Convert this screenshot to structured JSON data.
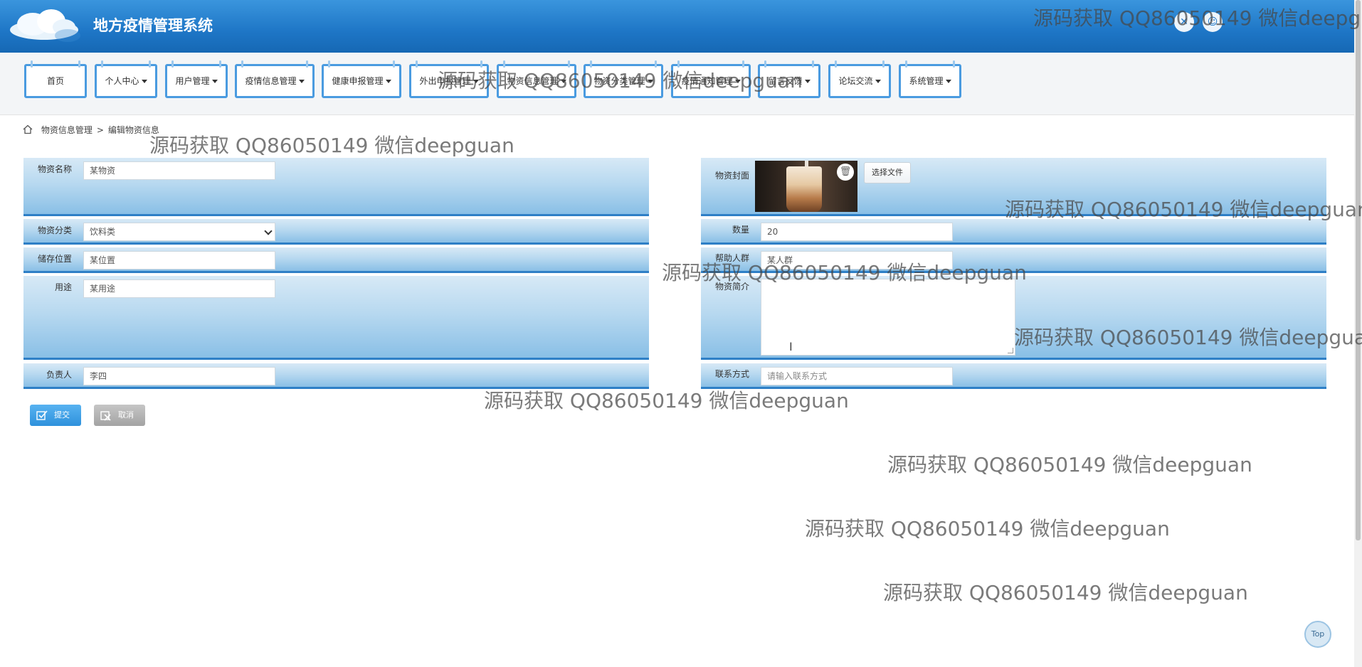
{
  "header": {
    "title": "地方疫情管理系统",
    "settings_icon": "gear-icon",
    "user_icon": "user-icon"
  },
  "nav": {
    "items": [
      {
        "label": "首页"
      },
      {
        "label": "个人中心"
      },
      {
        "label": "用户管理"
      },
      {
        "label": "疫情信息管理"
      },
      {
        "label": "健康申报管理"
      },
      {
        "label": "外出申报管理"
      },
      {
        "label": "物资信息管理"
      },
      {
        "label": "物资分类管理"
      },
      {
        "label": "疫情通知管理"
      },
      {
        "label": "留言反馈"
      },
      {
        "label": "论坛交流"
      },
      {
        "label": "系统管理"
      }
    ]
  },
  "breadcrumb": {
    "parent": "物资信息管理",
    "separator": ">",
    "current": "编辑物资信息"
  },
  "form": {
    "name": {
      "label": "物资名称",
      "value": "某物资"
    },
    "cover": {
      "label": "物资封面",
      "choose_file": "选择文件"
    },
    "category": {
      "label": "物资分类",
      "value": "饮料类"
    },
    "quantity": {
      "label": "数量",
      "value": "20"
    },
    "location": {
      "label": "储存位置",
      "value": "某位置"
    },
    "people": {
      "label": "帮助人群",
      "value": "某人群"
    },
    "usage": {
      "label": "用途",
      "value": "某用途"
    },
    "intro": {
      "label": "物资简介",
      "value": ""
    },
    "owner": {
      "label": "负责人",
      "value": "李四"
    },
    "contact": {
      "label": "联系方式",
      "placeholder": "请输入联系方式"
    }
  },
  "buttons": {
    "submit": "提交",
    "cancel": "取消",
    "top": "Top"
  },
  "watermark": "源码获取 QQ86050149 微信deepguan"
}
